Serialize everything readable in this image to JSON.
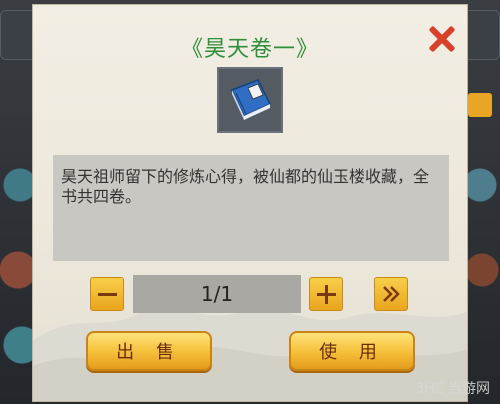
{
  "item": {
    "title": "《昊天卷一》",
    "icon": "blue-book-icon",
    "description": "昊天祖师留下的修炼心得，被仙都的仙玉楼收藏，全书共四卷。"
  },
  "quantity": {
    "value": "1/1"
  },
  "buttons": {
    "sell": "出 售",
    "use": "使 用"
  },
  "watermark": "3HE 当游网",
  "colors": {
    "title": "#2f8e3a",
    "button": "#f6c23b",
    "close": "#d8402a"
  }
}
